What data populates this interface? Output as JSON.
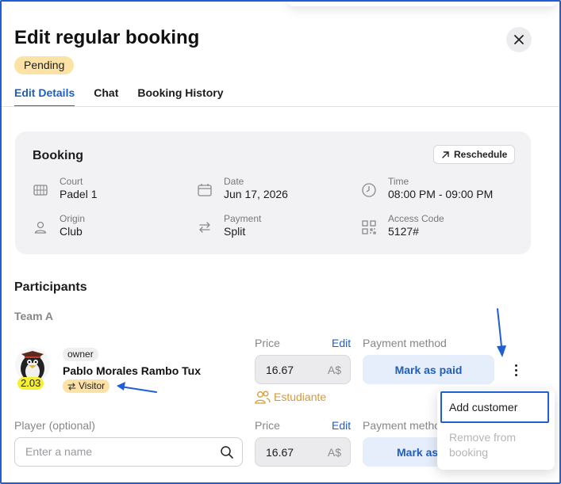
{
  "title": "Edit regular booking",
  "status": "Pending",
  "tabs": [
    {
      "label": "Edit Details",
      "active": true
    },
    {
      "label": "Chat",
      "active": false
    },
    {
      "label": "Booking History",
      "active": false
    }
  ],
  "booking": {
    "title": "Booking",
    "reschedule_label": "Reschedule",
    "fields": {
      "court": {
        "label": "Court",
        "value": "Padel 1",
        "icon": "court-icon"
      },
      "date": {
        "label": "Date",
        "value": "Jun 17, 2026",
        "icon": "calendar-icon"
      },
      "time": {
        "label": "Time",
        "value": "08:00 PM - 09:00 PM",
        "icon": "clock-icon"
      },
      "origin": {
        "label": "Origin",
        "value": "Club",
        "icon": "user-icon"
      },
      "payment": {
        "label": "Payment",
        "value": "Split",
        "icon": "split-arrows-icon"
      },
      "access_code": {
        "label": "Access Code",
        "value": "5127#",
        "icon": "qr-code-icon"
      }
    }
  },
  "participants": {
    "title": "Participants",
    "team_label": "Team A",
    "player": {
      "rating": "2.03",
      "role": "owner",
      "name": "Pablo Morales Rambo Tux",
      "visitor_label": "Visitor",
      "price_label": "Price",
      "edit_label": "Edit",
      "price_value": "16.67",
      "currency": "A$",
      "payment_method_label": "Payment method",
      "mark_paid_label": "Mark as paid",
      "discount_label": "Estudiante"
    },
    "optional_player": {
      "label": "Player (optional)",
      "placeholder": "Enter a name",
      "price_label": "Price",
      "edit_label": "Edit",
      "price_value": "16.67",
      "currency": "A$",
      "payment_method_label": "Payment metho",
      "mark_paid_label": "Mark as"
    }
  },
  "menu": {
    "add_customer": "Add customer",
    "remove_from_booking": "Remove from booking"
  },
  "colors": {
    "accent": "#1f5fbe",
    "status_badge": "#fde2a6",
    "annotation": "#1f5fd6",
    "rating_badge": "#f4f03a",
    "discount": "#d99a33"
  }
}
